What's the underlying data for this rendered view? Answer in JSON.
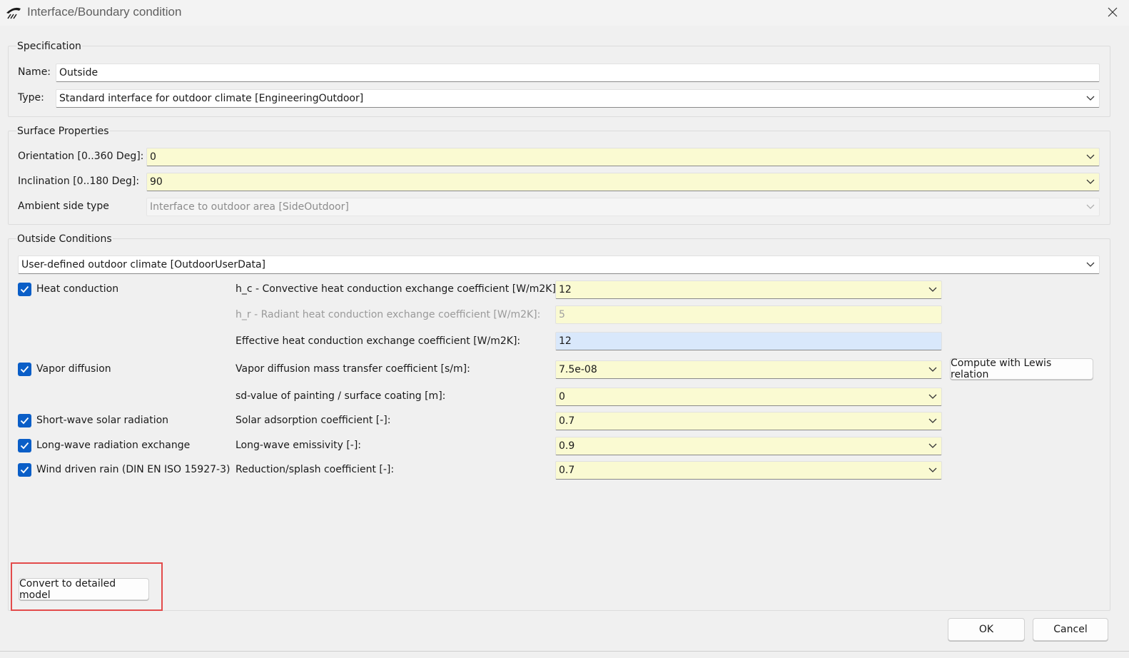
{
  "window": {
    "title": "Interface/Boundary condition"
  },
  "specification": {
    "title": "Specification",
    "name_label": "Name:",
    "name_value": "Outside",
    "type_label": "Type:",
    "type_value": "Standard interface for outdoor climate [EngineeringOutdoor]"
  },
  "surface": {
    "title": "Surface Properties",
    "orientation_label": "Orientation [0..360 Deg]:",
    "orientation_value": "0",
    "inclination_label": "Inclination [0..180 Deg]:",
    "inclination_value": "90",
    "ambient_label": "Ambient side type",
    "ambient_value": "Interface to outdoor area [SideOutdoor]"
  },
  "outside": {
    "title": "Outside Conditions",
    "climate_value": "User-defined outdoor climate [OutdoorUserData]",
    "heat_conduction": {
      "checkbox_label": "Heat conduction",
      "checked": true,
      "hc_label": "h_c - Convective heat conduction exchange coefficient [W/m2K]:",
      "hc_value": "12",
      "hr_label": "h_r - Radiant heat conduction exchange coefficient [W/m2K]:",
      "hr_value": "5",
      "eff_label": "Effective heat conduction exchange coefficient [W/m2K]:",
      "eff_value": "12"
    },
    "vapor": {
      "checkbox_label": "Vapor diffusion",
      "checked": true,
      "mass_label": "Vapor diffusion mass transfer coefficient [s/m]:",
      "mass_value": "7.5e-08",
      "lewis_button": "Compute with Lewis relation",
      "sd_label": "sd-value of painting / surface coating [m]:",
      "sd_value": "0"
    },
    "shortwave": {
      "checkbox_label": "Short-wave solar radiation",
      "checked": true,
      "label": "Solar adsorption coefficient [-]:",
      "value": "0.7"
    },
    "longwave": {
      "checkbox_label": "Long-wave radiation exchange",
      "checked": true,
      "label": "Long-wave emissivity [-]:",
      "value": "0.9"
    },
    "rain": {
      "checkbox_label": "Wind driven rain (DIN EN ISO 15927-3)",
      "checked": true,
      "label": "Reduction/splash coefficient [-]:",
      "value": "0.7"
    }
  },
  "buttons": {
    "convert": "Convert to detailed model",
    "ok": "OK",
    "cancel": "Cancel"
  },
  "colors": {
    "accent": "#0a5ec7",
    "input_yellow": "#fafad2",
    "input_blue": "#d9e8fb",
    "highlight": "#e34b4b"
  }
}
